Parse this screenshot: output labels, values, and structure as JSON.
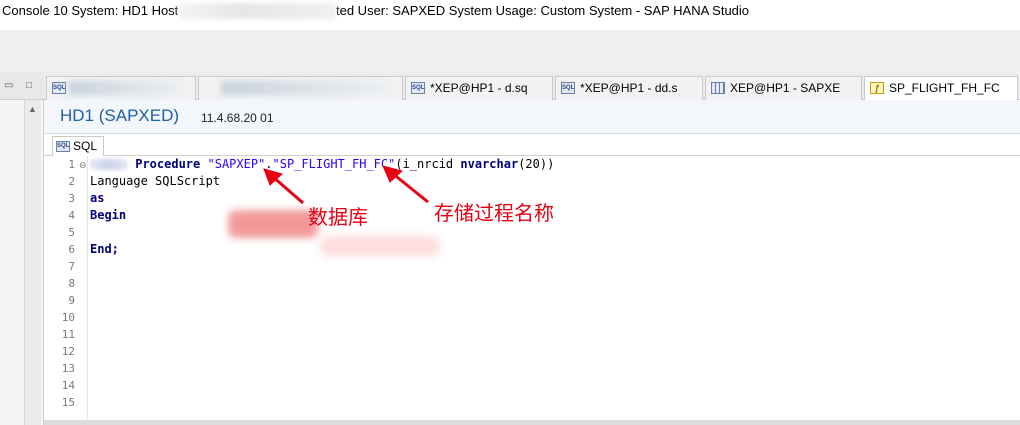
{
  "window": {
    "title_start": "Console 10 System: HD1 Host",
    "title_end": "ted User: SAPXED System Usage: Custom System - SAP HANA Studio"
  },
  "tabs": [
    {
      "label": "",
      "icon": "sql-icon",
      "redacted": true
    },
    {
      "label": "",
      "icon": "none",
      "redacted": true
    },
    {
      "label": "*XEP@HP1 - d.sq",
      "icon": "sql-icon"
    },
    {
      "label": "*XEP@HP1 - dd.s",
      "icon": "sql-icon"
    },
    {
      "label": "XEP@HP1 - SAPXE",
      "icon": "table-icon"
    },
    {
      "label": "SP_FLIGHT_FH_FC",
      "icon": "procedure-icon"
    }
  ],
  "connection": {
    "system": "HD1 (SAPXED)",
    "version": "11.4.68.20 01"
  },
  "editor": {
    "subtab": "SQL",
    "icon_text": "SQL",
    "line_numbers": [
      "1",
      "2",
      "3",
      "4",
      "5",
      "6",
      "7",
      "8",
      "9",
      "10",
      "11",
      "12",
      "13",
      "14",
      "15"
    ],
    "line1": {
      "kw": "Procedure",
      "schema": "\"SAPXEP\"",
      "dot": ".",
      "name": "\"SP_FLIGHT_FH_FC\"",
      "open": "(i_nrcid ",
      "type": "nvarchar",
      "close": "(20))"
    },
    "line2": "Language SQLScript",
    "line3": "as",
    "line4": "Begin",
    "line6": "End;"
  },
  "annotations": {
    "database": "数据库",
    "procedure_name": "存储过程名称",
    "color": "#e60012"
  }
}
